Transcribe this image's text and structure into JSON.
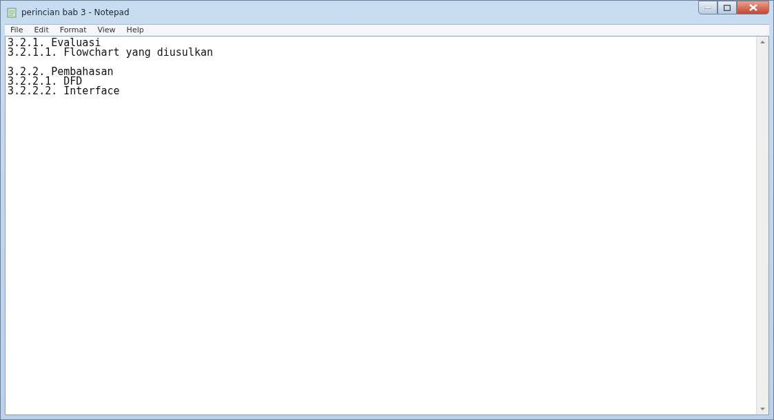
{
  "window": {
    "title": "perincian bab 3 - Notepad"
  },
  "menu": [
    "File",
    "Edit",
    "Format",
    "View",
    "Help"
  ],
  "editor": {
    "paragraphs": [
      [
        "3.2.1. Evaluasi",
        "3.2.1.1. Flowchart yang diusulkan"
      ],
      [
        "3.2.2. Pembahasan",
        "3.2.2.1. DFD",
        "3.2.2.2. Interface"
      ]
    ]
  }
}
